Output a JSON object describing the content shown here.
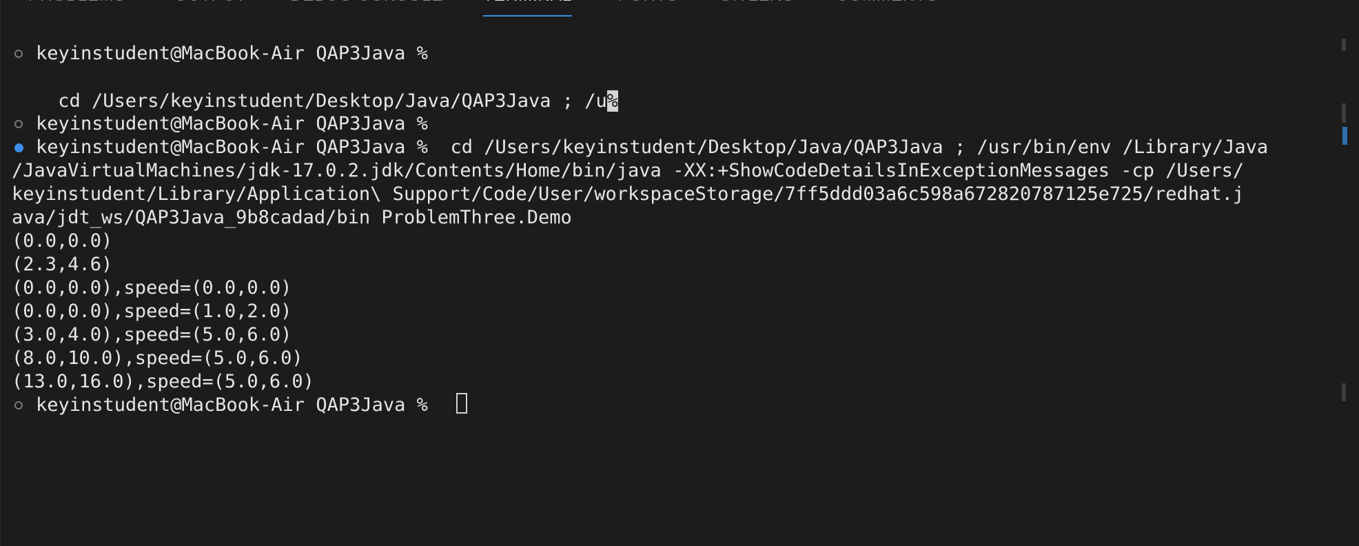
{
  "tabs": [
    {
      "label": "PROBLEMS"
    },
    {
      "label": "OUTPUT"
    },
    {
      "label": "DEBUG CONSOLE"
    },
    {
      "label": "TERMINAL"
    },
    {
      "label": "PORTS"
    },
    {
      "label": "GITLENS"
    },
    {
      "label": "COMMENTS"
    }
  ],
  "active_tab": "TERMINAL",
  "terminal": {
    "lines": [
      "keyinstudent@MacBook-Air QAP3Java %",
      " cd /Users/keyinstudent/Desktop/Java/QAP3Java ; /u",
      "keyinstudent@MacBook-Air QAP3Java %",
      "keyinstudent@MacBook-Air QAP3Java %  cd /Users/keyinstudent/Desktop/Java/QAP3Java ; /usr/bin/env /Library/Java",
      "/JavaVirtualMachines/jdk-17.0.2.jdk/Contents/Home/bin/java -XX:+ShowCodeDetailsInExceptionMessages -cp /Users/",
      "keyinstudent/Library/Application\\ Support/Code/User/workspaceStorage/7ff5ddd03a6c598a672820787125e725/redhat.j",
      "ava/jdt_ws/QAP3Java_9b8cadad/bin ProblemThree.Demo",
      "(0.0,0.0)",
      "(2.3,4.6)",
      "(0.0,0.0),speed=(0.0,0.0)",
      "(0.0,0.0),speed=(1.0,2.0)",
      "(3.0,4.0),speed=(5.0,6.0)",
      "(8.0,10.0),speed=(5.0,6.0)",
      "(13.0,16.0),speed=(5.0,6.0)",
      "keyinstudent@MacBook-Air QAP3Java %"
    ],
    "highlighted_char": "%"
  },
  "colors": {
    "background": "#1c1c1c",
    "text": "#e6e6e6",
    "accent": "#3b8eea",
    "inactive_tab": "#8b8b8b"
  }
}
